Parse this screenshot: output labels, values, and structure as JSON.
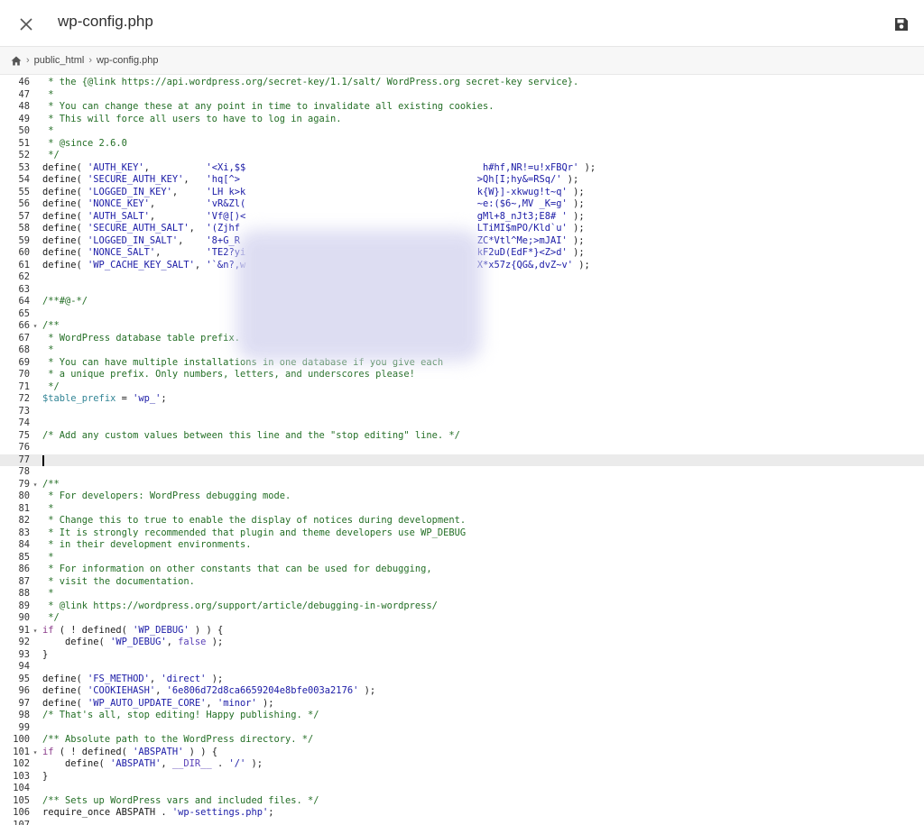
{
  "header": {
    "title": "wp-config.php",
    "close_icon": "close-icon",
    "save_icon": "save-icon"
  },
  "breadcrumb": {
    "home_icon": "home-icon",
    "items": [
      "public_html",
      "wp-config.php"
    ]
  },
  "editor": {
    "active_line": 77,
    "lines": [
      {
        "n": "46",
        "t": "c",
        "s": " * the {@link https://api.wordpress.org/secret-key/1.1/salt/ WordPress.org secret-key service}."
      },
      {
        "n": "47",
        "t": "c",
        "s": " *"
      },
      {
        "n": "48",
        "t": "c",
        "s": " * You can change these at any point in time to invalidate all existing cookies."
      },
      {
        "n": "49",
        "t": "c",
        "s": " * This will force all users to have to log in again."
      },
      {
        "n": "50",
        "t": "c",
        "s": " *"
      },
      {
        "n": "51",
        "t": "c",
        "s": " * @since 2.6.0"
      },
      {
        "n": "52",
        "t": "c",
        "s": " */"
      },
      {
        "n": "53",
        "t": "p",
        "s": "define( 'AUTH_KEY',          '<Xi,$$                                          h#hf,NR!=u!xFBQr' );"
      },
      {
        "n": "54",
        "t": "p",
        "s": "define( 'SECURE_AUTH_KEY',   'hq[^>                                          >Qh[I;hy&=RSq/' );"
      },
      {
        "n": "55",
        "t": "p",
        "s": "define( 'LOGGED_IN_KEY',     'LH k>k                                         k{W}]-xkwug!t~q' );"
      },
      {
        "n": "56",
        "t": "p",
        "s": "define( 'NONCE_KEY',         'vR&Zl(                                         ~e:($6~,MV _K=g' );"
      },
      {
        "n": "57",
        "t": "p",
        "s": "define( 'AUTH_SALT',         'Vf@[)<                                         gMl+8_nJt3;E8# ' );"
      },
      {
        "n": "58",
        "t": "p",
        "s": "define( 'SECURE_AUTH_SALT',  '(Zjhf                                          LTiMI$mPO/Kld`u' );"
      },
      {
        "n": "59",
        "t": "p",
        "s": "define( 'LOGGED_IN_SALT',    '8+G_R                                          ZC*Vtl^Me;>mJAI' );"
      },
      {
        "n": "60",
        "t": "p",
        "s": "define( 'NONCE_SALT',        'TE2?yi                                         kF2uD(EdF*}<Z>d' );"
      },
      {
        "n": "61",
        "t": "p",
        "s": "define( 'WP_CACHE_KEY_SALT', '`&n?,w                                         X*x57z{QG&,dvZ~v' );"
      },
      {
        "n": "62",
        "t": "p",
        "s": ""
      },
      {
        "n": "63",
        "t": "p",
        "s": ""
      },
      {
        "n": "64",
        "t": "c",
        "s": "/**#@-*/"
      },
      {
        "n": "65",
        "t": "p",
        "s": ""
      },
      {
        "n": "66",
        "t": "c",
        "s": "/**",
        "f": "▾"
      },
      {
        "n": "67",
        "t": "c",
        "s": " * WordPress database table prefix."
      },
      {
        "n": "68",
        "t": "c",
        "s": " *"
      },
      {
        "n": "69",
        "t": "c",
        "s": " * You can have multiple installations in one database if you give each"
      },
      {
        "n": "70",
        "t": "c",
        "s": " * a unique prefix. Only numbers, letters, and underscores please!"
      },
      {
        "n": "71",
        "t": "c",
        "s": " */"
      },
      {
        "n": "72",
        "t": "v",
        "s": "$table_prefix = 'wp_';"
      },
      {
        "n": "73",
        "t": "p",
        "s": ""
      },
      {
        "n": "74",
        "t": "p",
        "s": ""
      },
      {
        "n": "75",
        "t": "c",
        "s": "/* Add any custom values between this line and the \"stop editing\" line. */"
      },
      {
        "n": "76",
        "t": "p",
        "s": ""
      },
      {
        "n": "77",
        "t": "p",
        "s": ""
      },
      {
        "n": "78",
        "t": "p",
        "s": ""
      },
      {
        "n": "79",
        "t": "c",
        "s": "/**",
        "f": "▾"
      },
      {
        "n": "80",
        "t": "c",
        "s": " * For developers: WordPress debugging mode."
      },
      {
        "n": "81",
        "t": "c",
        "s": " *"
      },
      {
        "n": "82",
        "t": "c",
        "s": " * Change this to true to enable the display of notices during development."
      },
      {
        "n": "83",
        "t": "c",
        "s": " * It is strongly recommended that plugin and theme developers use WP_DEBUG"
      },
      {
        "n": "84",
        "t": "c",
        "s": " * in their development environments."
      },
      {
        "n": "85",
        "t": "c",
        "s": " *"
      },
      {
        "n": "86",
        "t": "c",
        "s": " * For information on other constants that can be used for debugging,"
      },
      {
        "n": "87",
        "t": "c",
        "s": " * visit the documentation."
      },
      {
        "n": "88",
        "t": "c",
        "s": " *"
      },
      {
        "n": "89",
        "t": "c",
        "s": " * @link https://wordpress.org/support/article/debugging-in-wordpress/"
      },
      {
        "n": "90",
        "t": "c",
        "s": " */"
      },
      {
        "n": "91",
        "t": "k",
        "s": "if ( ! defined( 'WP_DEBUG' ) ) {",
        "f": "▾"
      },
      {
        "n": "92",
        "t": "b",
        "s": "    define( 'WP_DEBUG', false );"
      },
      {
        "n": "93",
        "t": "p",
        "s": "}"
      },
      {
        "n": "94",
        "t": "p",
        "s": ""
      },
      {
        "n": "95",
        "t": "p",
        "s": "define( 'FS_METHOD', 'direct' );"
      },
      {
        "n": "96",
        "t": "p",
        "s": "define( 'COOKIEHASH', '6e806d72d8ca6659204e8bfe003a2176' );"
      },
      {
        "n": "97",
        "t": "p",
        "s": "define( 'WP_AUTO_UPDATE_CORE', 'minor' );"
      },
      {
        "n": "98",
        "t": "c",
        "s": "/* That's all, stop editing! Happy publishing. */"
      },
      {
        "n": "99",
        "t": "p",
        "s": ""
      },
      {
        "n": "100",
        "t": "c",
        "s": "/** Absolute path to the WordPress directory. */"
      },
      {
        "n": "101",
        "t": "k",
        "s": "if ( ! defined( 'ABSPATH' ) ) {",
        "f": "▾"
      },
      {
        "n": "102",
        "t": "p",
        "s": "    define( 'ABSPATH', __DIR__ . '/' );"
      },
      {
        "n": "103",
        "t": "p",
        "s": "}"
      },
      {
        "n": "104",
        "t": "p",
        "s": ""
      },
      {
        "n": "105",
        "t": "c",
        "s": "/** Sets up WordPress vars and included files. */"
      },
      {
        "n": "106",
        "t": "p",
        "s": "require_once ABSPATH . 'wp-settings.php';"
      },
      {
        "n": "107",
        "t": "p",
        "s": ""
      }
    ]
  },
  "colors": {
    "comment": "#236e25",
    "string": "#1a1aa6",
    "variable": "#318495",
    "keyword": "#8a3a8a",
    "active_line": "#ebebeb"
  }
}
